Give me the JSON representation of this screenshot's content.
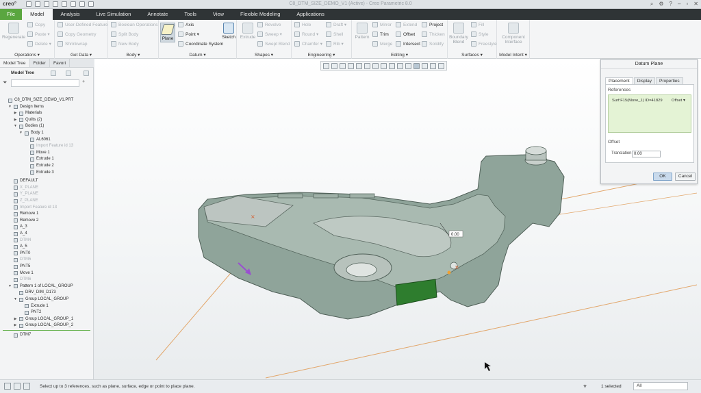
{
  "app": {
    "logo": "creo°",
    "window_title": "C8_DTM_SIZE_DEMO_V1 (Active) - Creo Parametric 8.0"
  },
  "tabs": [
    "File",
    "Model",
    "Analysis",
    "Live Simulation",
    "Annotate",
    "Tools",
    "View",
    "Flexible Modeling",
    "Applications"
  ],
  "ribbon": {
    "operations": {
      "label": "Operations ▾",
      "regenerate": "Regenerate",
      "copy": "Copy",
      "paste": "Paste ▾",
      "delete": "Delete ▾"
    },
    "get_data": {
      "label": "Get Data ▾",
      "udf": "User-Defined Feature",
      "copy_geometry": "Copy Geometry",
      "shrinkwrap": "Shrinkwrap"
    },
    "body": {
      "label": "Body ▾",
      "boolean": "Boolean Operations",
      "split": "Split Body",
      "new": "New Body"
    },
    "datum": {
      "label": "Datum ▾",
      "plane": "Plane",
      "axis": "Axis",
      "point": "Point ▾",
      "csys": "Coordinate System",
      "sketch": "Sketch"
    },
    "shapes": {
      "label": "Shapes ▾",
      "extrude": "Extrude",
      "revolve": "Revolve",
      "sweep": "Sweep ▾",
      "swept_blend": "Swept Blend"
    },
    "engineering": {
      "label": "Engineering ▾",
      "hole": "Hole",
      "round": "Round ▾",
      "chamfer": "Chamfer ▾",
      "draft": "Draft ▾",
      "shell": "Shell",
      "rib": "Rib ▾"
    },
    "editing": {
      "label": "Editing ▾",
      "pattern": "Pattern",
      "mirror": "Mirror",
      "trim": "Trim",
      "merge": "Merge",
      "extend": "Extend",
      "offset": "Offset",
      "intersect": "Intersect",
      "project": "Project",
      "thicken": "Thicken",
      "solidify": "Solidify"
    },
    "surfaces": {
      "label": "Surfaces ▾",
      "boundary": "Boundary Blend",
      "fill": "Fill",
      "style": "Style",
      "freestyle": "Freestyle"
    },
    "model_intent": {
      "label": "Model Intent ▾",
      "component": "Component Interface"
    }
  },
  "left_panel": {
    "tabs": [
      "Model Tree",
      "Folder",
      "Favori"
    ],
    "header": "Model Tree",
    "tree": [
      {
        "label": "C8_DTM_SIZE_DEMO_V1.PRT",
        "indent": 0,
        "dim": false,
        "tw": ""
      },
      {
        "label": "Design Items",
        "indent": 1,
        "dim": false,
        "tw": "▼"
      },
      {
        "label": "Materials",
        "indent": 2,
        "dim": false,
        "tw": "▶"
      },
      {
        "label": "Quilts (2)",
        "indent": 2,
        "dim": false,
        "tw": "▶"
      },
      {
        "label": "Bodies (1)",
        "indent": 2,
        "dim": false,
        "tw": "▼"
      },
      {
        "label": "Body 1",
        "indent": 3,
        "dim": false,
        "tw": "▼"
      },
      {
        "label": "AL6061",
        "indent": 4,
        "dim": false,
        "tw": ""
      },
      {
        "label": "Import Feature id 13",
        "indent": 4,
        "dim": true,
        "tw": ""
      },
      {
        "label": "Move 1",
        "indent": 4,
        "dim": false,
        "tw": ""
      },
      {
        "label": "Extrude 1",
        "indent": 4,
        "dim": false,
        "tw": ""
      },
      {
        "label": "Extrude 2",
        "indent": 4,
        "dim": false,
        "tw": ""
      },
      {
        "label": "Extrude 3",
        "indent": 4,
        "dim": false,
        "tw": ""
      },
      {
        "label": "DEFAULT",
        "indent": 1,
        "dim": false,
        "tw": ""
      },
      {
        "label": "X_PLANE",
        "indent": 1,
        "dim": true,
        "tw": ""
      },
      {
        "label": "Y_PLANE",
        "indent": 1,
        "dim": true,
        "tw": ""
      },
      {
        "label": "Z_PLANE",
        "indent": 1,
        "dim": true,
        "tw": ""
      },
      {
        "label": "Import Feature id 13",
        "indent": 1,
        "dim": true,
        "tw": ""
      },
      {
        "label": "Remove 1",
        "indent": 1,
        "dim": false,
        "tw": ""
      },
      {
        "label": "Remove 2",
        "indent": 1,
        "dim": false,
        "tw": ""
      },
      {
        "label": "A_3",
        "indent": 1,
        "dim": false,
        "tw": ""
      },
      {
        "label": "A_4",
        "indent": 1,
        "dim": false,
        "tw": ""
      },
      {
        "label": "DTM4",
        "indent": 1,
        "dim": true,
        "tw": ""
      },
      {
        "label": "A_5",
        "indent": 1,
        "dim": false,
        "tw": ""
      },
      {
        "label": "PNT0",
        "indent": 1,
        "dim": false,
        "tw": ""
      },
      {
        "label": "DTM5",
        "indent": 1,
        "dim": true,
        "tw": ""
      },
      {
        "label": "PNT5",
        "indent": 1,
        "dim": false,
        "tw": ""
      },
      {
        "label": "Move 1",
        "indent": 1,
        "dim": false,
        "tw": ""
      },
      {
        "label": "DTM6",
        "indent": 1,
        "dim": true,
        "tw": ""
      },
      {
        "label": "Pattern 1 of LOCAL_GROUP",
        "indent": 1,
        "dim": false,
        "tw": "▼"
      },
      {
        "label": "DRV_DIM_D173",
        "indent": 2,
        "dim": false,
        "tw": ""
      },
      {
        "label": "Group LOCAL_GROUP",
        "indent": 2,
        "dim": false,
        "tw": "▼"
      },
      {
        "label": "Extrude 1",
        "indent": 3,
        "dim": false,
        "tw": ""
      },
      {
        "label": "PNT2",
        "indent": 3,
        "dim": false,
        "tw": ""
      },
      {
        "label": "Group LOCAL_GROUP_1",
        "indent": 2,
        "dim": false,
        "tw": "▶"
      },
      {
        "label": "Group LOCAL_GROUP_2",
        "indent": 2,
        "dim": false,
        "tw": "▶"
      },
      {
        "label": "DTM7",
        "indent": 1,
        "dim": false,
        "tw": ""
      }
    ]
  },
  "viewport": {
    "offset_value": "0.00"
  },
  "dialog": {
    "title": "Datum Plane",
    "tabs": [
      "Placement",
      "Display",
      "Properties"
    ],
    "references_label": "References",
    "reference": "Surf:F15(Move_1) ID=41829",
    "reference_type": "Offset ▾",
    "offset_label": "Offset",
    "translation_label": "Translation",
    "translation_value": "0.00",
    "ok": "OK",
    "cancel": "Cancel"
  },
  "status": {
    "message": "Select up to 3 references, such as plane, surface, edge or point to place plane.",
    "selected": "1 selected",
    "filter": "All"
  },
  "colors": {
    "file_tab": "#5aa640",
    "model_body": "#7d9a8a",
    "selected_face": "#2e7d2e",
    "datum_orange": "#e0a060"
  }
}
